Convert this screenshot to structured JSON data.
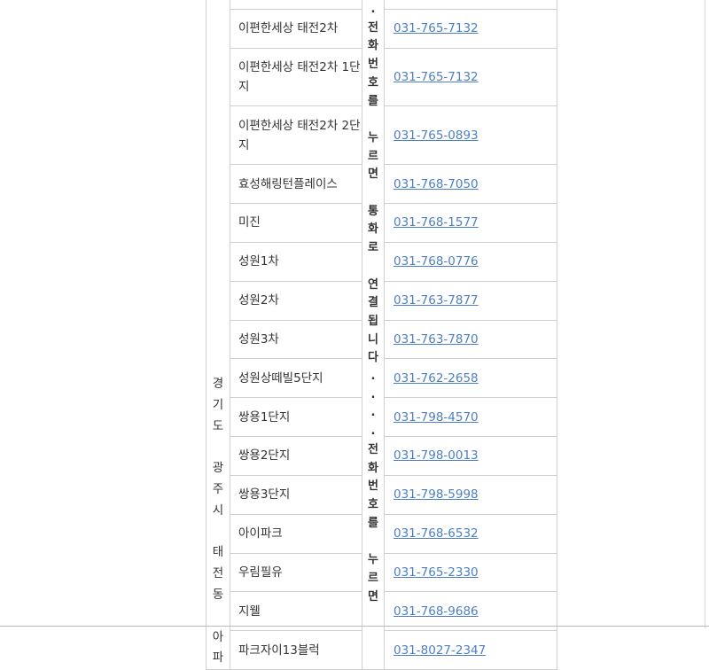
{
  "region_label": [
    "경",
    "기",
    "도",
    " ",
    "광",
    "주",
    "시",
    " ",
    "태",
    "전",
    "동",
    " ",
    "아",
    "파"
  ],
  "note_label": [
    ".",
    "전",
    "화",
    "번",
    "호",
    "를",
    " ",
    "누",
    "르",
    "면",
    " ",
    "통",
    "화",
    "로",
    " ",
    "연",
    "결",
    "됩",
    "니",
    "다",
    ".",
    ".",
    ".",
    ".",
    "전",
    "화",
    "번",
    "호",
    "를",
    " ",
    "누",
    "르",
    "면"
  ],
  "rows": [
    {
      "name": "",
      "phone": ""
    },
    {
      "name": "이편한세상 태전2차",
      "phone": "031-765-7132"
    },
    {
      "name": "이편한세상 태전2차 1단지",
      "phone": "031-765-7132"
    },
    {
      "name": "이편한세상 태전2차 2단지",
      "phone": "031-765-0893"
    },
    {
      "name": "효성해링턴플레이스",
      "phone": "031-768-7050"
    },
    {
      "name": "미진",
      "phone": "031-768-1577"
    },
    {
      "name": "성원1차",
      "phone": "031-768-0776"
    },
    {
      "name": "성원2차",
      "phone": "031-763-7877"
    },
    {
      "name": "성원3차",
      "phone": "031-763-7870"
    },
    {
      "name": "성원상떼빌5단지",
      "phone": "031-762-2658"
    },
    {
      "name": "쌍용1단지",
      "phone": "031-798-4570"
    },
    {
      "name": "쌍용2단지",
      "phone": "031-798-0013"
    },
    {
      "name": "쌍용3단지",
      "phone": "031-798-5998"
    },
    {
      "name": "아이파크",
      "phone": "031-768-6532"
    },
    {
      "name": "우림필유",
      "phone": "031-765-2330"
    },
    {
      "name": "지웰",
      "phone": "031-768-9686"
    },
    {
      "name": "파크자이13블럭",
      "phone": "031-8027-2347"
    }
  ]
}
